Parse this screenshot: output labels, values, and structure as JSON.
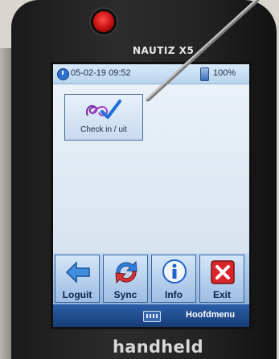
{
  "device": {
    "model": "NAUTIZ X5",
    "brand": "handheld"
  },
  "statusbar": {
    "datetime": "05-02-19 09:52",
    "battery": "100%"
  },
  "home": {
    "tiles": [
      {
        "label": "Check in / uit",
        "icon": "check-in-icon"
      }
    ]
  },
  "toolbar": {
    "buttons": [
      {
        "label": "Loguit",
        "icon": "logout-arrow-icon"
      },
      {
        "label": "Sync",
        "icon": "sync-icon"
      },
      {
        "label": "Info",
        "icon": "info-icon"
      },
      {
        "label": "Exit",
        "icon": "exit-x-icon"
      }
    ]
  },
  "menubar": {
    "label": "Hoofdmenu",
    "keyboard_icon": "keyboard-icon"
  },
  "colors": {
    "exit_red": "#d9262b",
    "info_blue": "#1d63c9",
    "screen_bg": "#eaf1f8",
    "menubar": "#1f4a8e"
  }
}
